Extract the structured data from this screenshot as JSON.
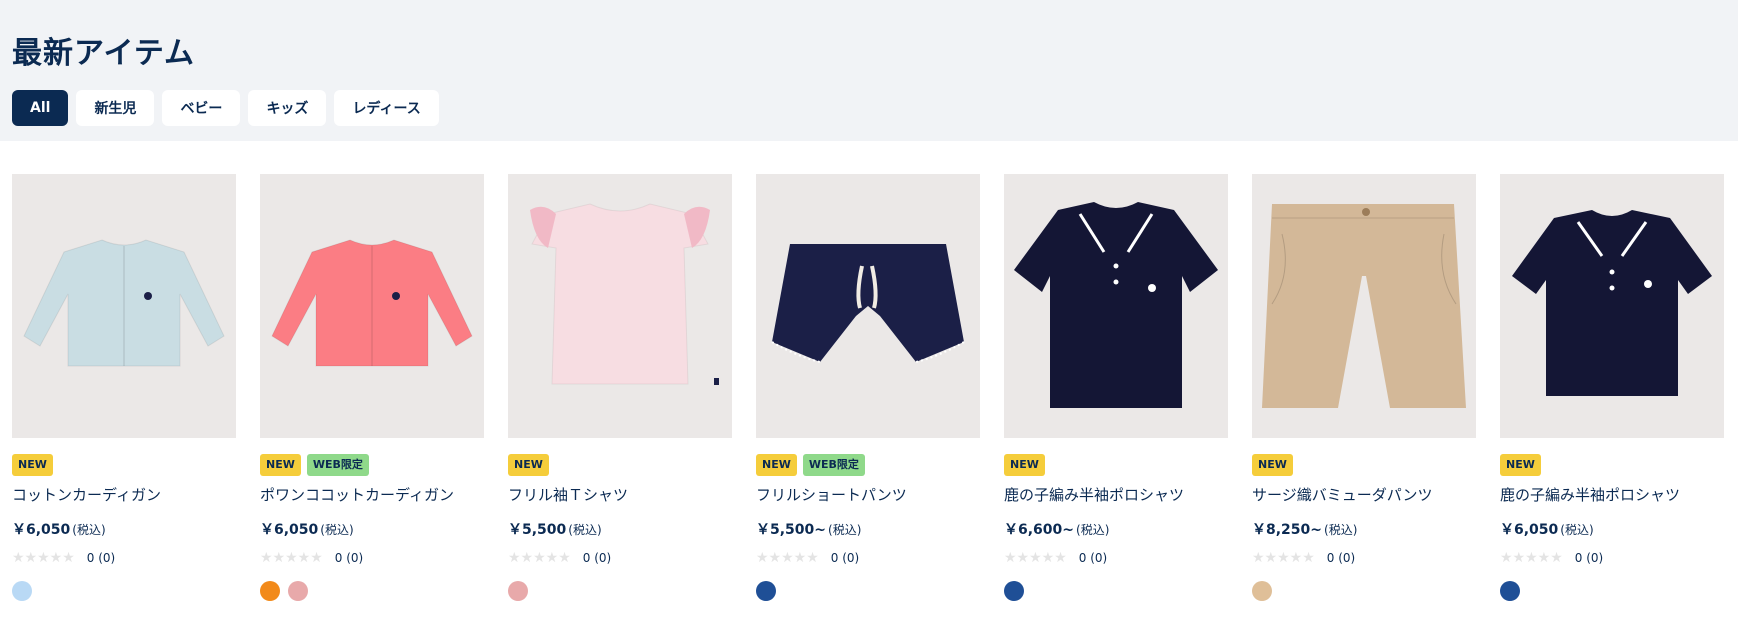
{
  "page": {
    "title": "最新アイテム"
  },
  "filters": [
    {
      "label": "All",
      "active": true
    },
    {
      "label": "新生児",
      "active": false
    },
    {
      "label": "ベビー",
      "active": false
    },
    {
      "label": "キッズ",
      "active": false
    },
    {
      "label": "レディース",
      "active": false
    }
  ],
  "badge_labels": {
    "new": "NEW",
    "web": "WEB限定"
  },
  "tax_label": "(税込)",
  "stars": "★★★★★",
  "products": [
    {
      "name": "コットンカーディガン",
      "price": "￥6,050",
      "rating": "0 (0)",
      "badges": [
        "NEW"
      ],
      "swatches": [
        "#b9d9f5"
      ],
      "garment": "cardigan",
      "garment_color": "#c9dde3"
    },
    {
      "name": "ポワンココットカーディガン",
      "price": "￥6,050",
      "rating": "0 (0)",
      "badges": [
        "NEW",
        "WEB限定"
      ],
      "swatches": [
        "#f28a1a",
        "#e8a9aa"
      ],
      "garment": "cardigan",
      "garment_color": "#fb7d84"
    },
    {
      "name": "フリル袖Ｔシャツ",
      "price": "￥5,500",
      "rating": "0 (0)",
      "badges": [
        "NEW"
      ],
      "swatches": [
        "#e8a9aa"
      ],
      "garment": "frill-top",
      "garment_color": "#f7dde2"
    },
    {
      "name": "フリルショートパンツ",
      "price": "￥5,500~",
      "rating": "0 (0)",
      "badges": [
        "NEW",
        "WEB限定"
      ],
      "swatches": [
        "#1f4f96"
      ],
      "garment": "shorts",
      "garment_color": "#1b1f47"
    },
    {
      "name": "鹿の子編み半袖ポロシャツ",
      "price": "￥6,600~",
      "rating": "0 (0)",
      "badges": [
        "NEW"
      ],
      "swatches": [
        "#1f4f96"
      ],
      "garment": "polo-long",
      "garment_color": "#141635"
    },
    {
      "name": "サージ織バミューダパンツ",
      "price": "￥8,250~",
      "rating": "0 (0)",
      "badges": [
        "NEW"
      ],
      "swatches": [
        "#dfbf98"
      ],
      "garment": "bermuda",
      "garment_color": "#d3b898"
    },
    {
      "name": "鹿の子編み半袖ポロシャツ",
      "price": "￥6,050",
      "rating": "0 (0)",
      "badges": [
        "NEW"
      ],
      "swatches": [
        "#1f4f96"
      ],
      "garment": "polo-short",
      "garment_color": "#141635"
    }
  ]
}
